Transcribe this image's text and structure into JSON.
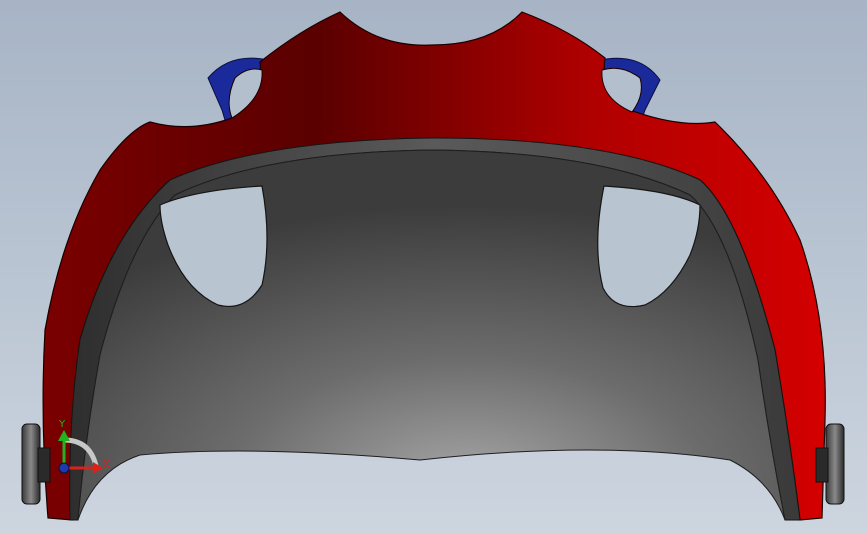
{
  "viewport": {
    "model": "bicycle-helmet",
    "view": "front"
  },
  "triad": {
    "x_label": "X",
    "y_label": "Y",
    "x_color": "#d9221a",
    "y_color": "#21b41f",
    "z_color": "#1e3aa8"
  },
  "colors": {
    "shell_red": "#c40000",
    "shell_dark_red": "#6a0000",
    "liner_gray": "#6a6a6a",
    "vent_blue": "#1a2a9a",
    "background_top": "#a7b4c5",
    "background_bottom": "#cdd5df"
  }
}
